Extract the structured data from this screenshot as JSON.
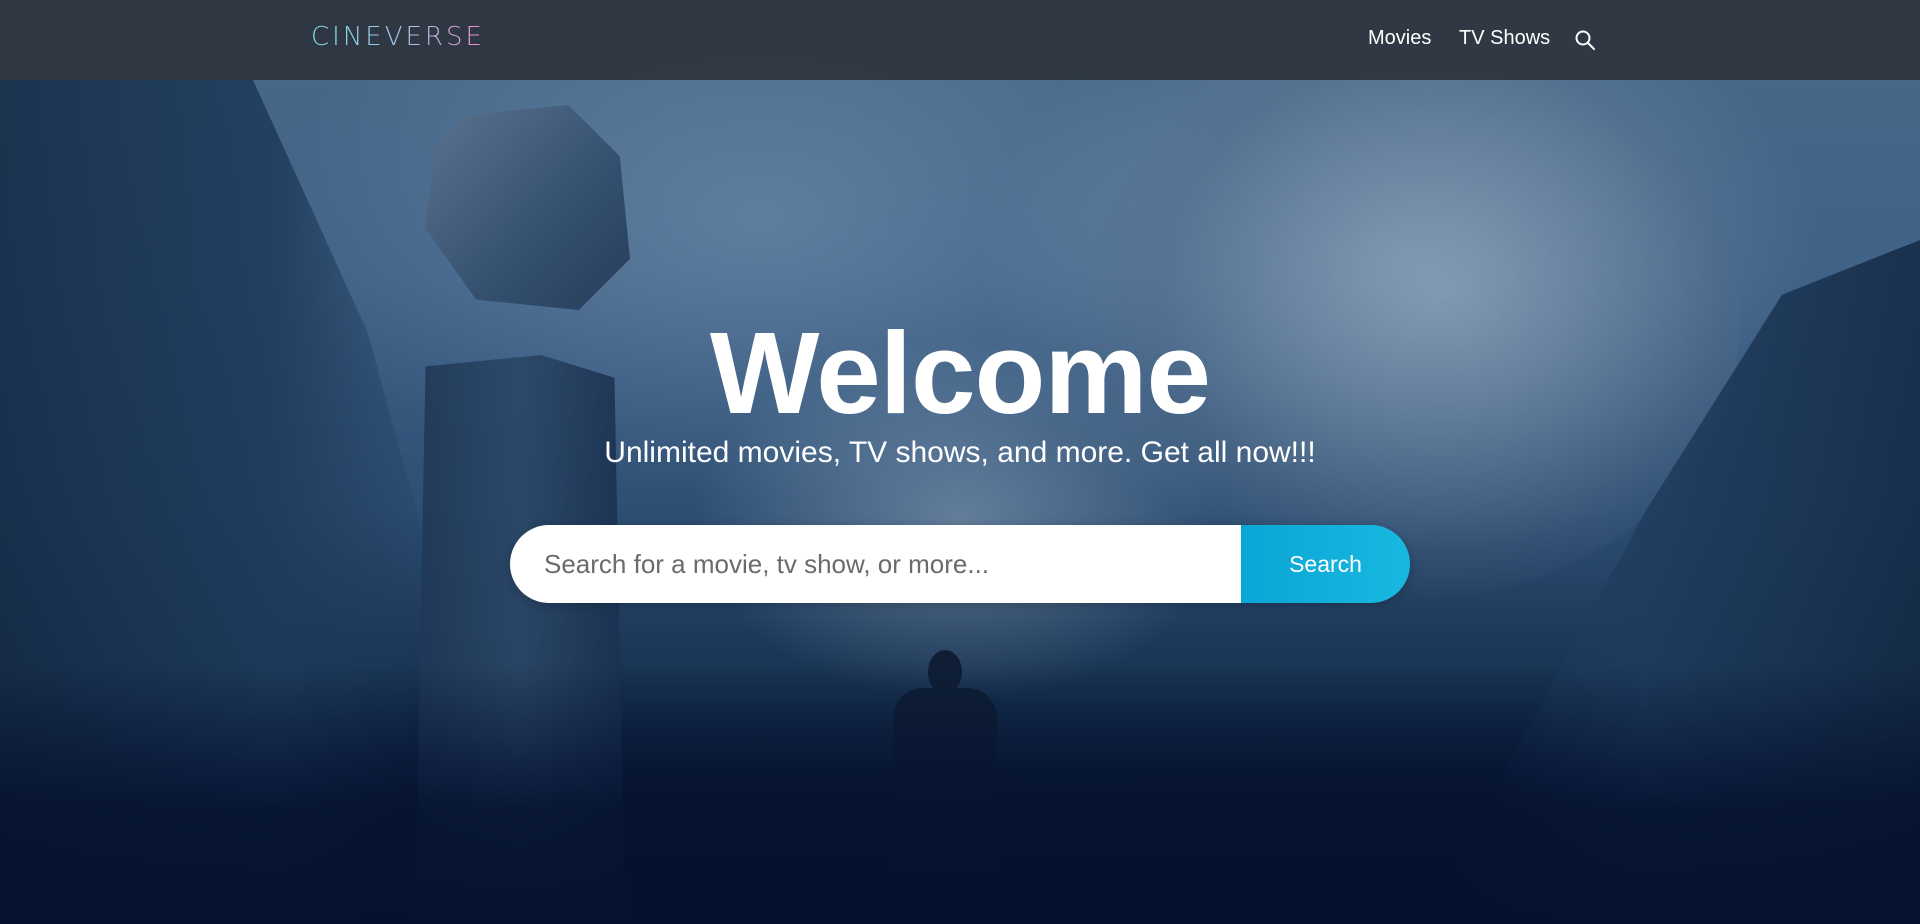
{
  "navbar": {
    "logo": "CINEVERSE",
    "links": [
      {
        "label": "Movies"
      },
      {
        "label": "TV Shows"
      }
    ],
    "search_icon": "search-icon"
  },
  "hero": {
    "title": "Welcome",
    "tagline": "Unlimited movies, TV shows, and more. Get all now!!!",
    "search": {
      "placeholder": "Search for a movie, tv show, or more...",
      "value": "",
      "button_label": "Search"
    }
  },
  "colors": {
    "navbar_bg": "#2c3036",
    "accent": "#0aa6d6",
    "page_bg": "#051130",
    "logo_gradient": [
      "#7fe0e8",
      "#f08ec8"
    ]
  }
}
